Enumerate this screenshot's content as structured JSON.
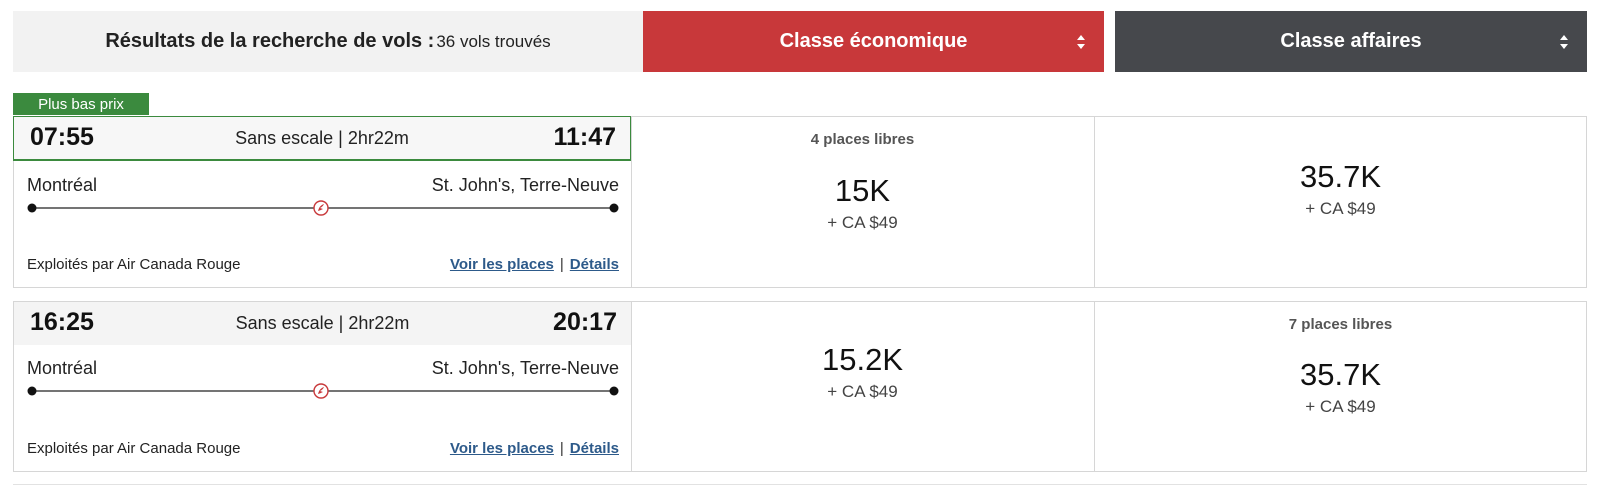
{
  "header": {
    "title": "Résultats de la recherche de vols :",
    "count": "36 vols trouvés",
    "cabins": [
      {
        "label": "Classe économique",
        "icon": "sort-icon",
        "color": "#c8383a"
      },
      {
        "label": "Classe affaires",
        "icon": "sort-icon",
        "color": "#46484c"
      }
    ]
  },
  "badge": {
    "label": "Plus bas prix",
    "color": "#3b8a3e"
  },
  "flights": [
    {
      "depart": "07:55",
      "info": "Sans escale | 2hr22m",
      "arrive": "11:47",
      "from": "Montréal",
      "to": "St. John's, Terre-Neuve",
      "carrier_icon": "air-canada-rouge-maple-leaf-icon",
      "operator": "Exploités par Air Canada Rouge",
      "seats_link": "Voir les places",
      "separator": "|",
      "details_link": "Détails",
      "economy": {
        "seats": "4 places libres",
        "price": "15K",
        "tax": "+ CA $49"
      },
      "business": {
        "seats": "",
        "price": "35.7K",
        "tax": "+ CA $49"
      }
    },
    {
      "depart": "16:25",
      "info": "Sans escale | 2hr22m",
      "arrive": "20:17",
      "from": "Montréal",
      "to": "St. John's, Terre-Neuve",
      "carrier_icon": "air-canada-rouge-maple-leaf-icon",
      "operator": "Exploités par Air Canada Rouge",
      "seats_link": "Voir les places",
      "separator": "|",
      "details_link": "Détails",
      "economy": {
        "seats": "",
        "price": "15.2K",
        "tax": "+ CA $49"
      },
      "business": {
        "seats": "7 places libres",
        "price": "35.7K",
        "tax": "+ CA $49"
      }
    }
  ]
}
